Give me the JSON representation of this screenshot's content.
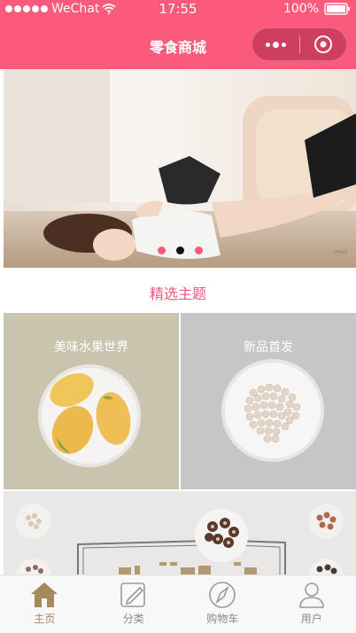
{
  "status_bar": {
    "carrier": "WeChat",
    "time": "17:55",
    "battery": "100%"
  },
  "nav": {
    "title": "零食商城",
    "more_icon": "more-dots-icon",
    "close_icon": "target-close-icon"
  },
  "banner": {
    "slides": 3,
    "active_index": 1,
    "watermark": "vmall"
  },
  "section": {
    "title": "精选主题"
  },
  "themes": [
    {
      "label": "美味水果世界",
      "bg": "#c9c4ae"
    },
    {
      "label": "新品首发",
      "bg": "#c6c6c7"
    }
  ],
  "tabs": [
    {
      "label": "主页",
      "icon": "home-icon",
      "active": true
    },
    {
      "label": "分类",
      "icon": "category-icon",
      "active": false
    },
    {
      "label": "购物车",
      "icon": "cart-compass-icon",
      "active": false
    },
    {
      "label": "用户",
      "icon": "user-icon",
      "active": false
    }
  ],
  "colors": {
    "brand": "#fb5a7c",
    "section_title": "#f0577c",
    "tab_active": "#a48a5c",
    "tab_inactive": "#888888"
  }
}
